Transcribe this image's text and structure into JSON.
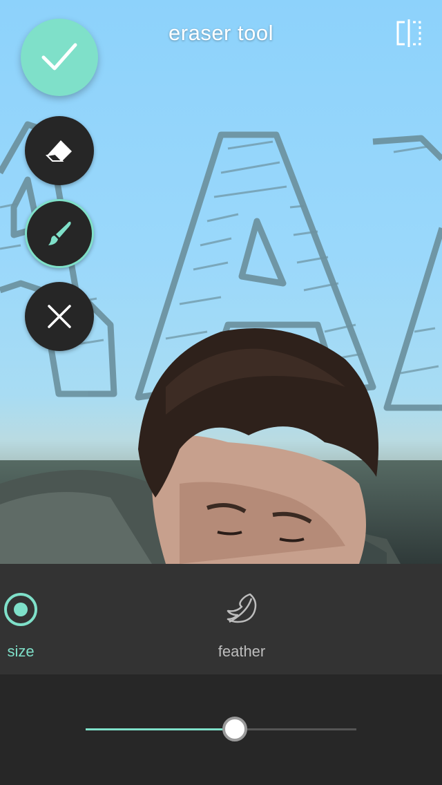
{
  "header": {
    "title": "eraser tool",
    "compare_icon": "split-compare-icon"
  },
  "tools": {
    "confirm_icon": "checkmark-icon",
    "eraser_icon": "eraser-icon",
    "brush_icon": "paintbrush-icon",
    "close_icon": "close-icon",
    "active_tool": "brush"
  },
  "options": [
    {
      "label": "size",
      "icon": "target-circle-icon",
      "active": true
    },
    {
      "label": "feather",
      "icon": "feather-icon",
      "active": false
    }
  ],
  "slider": {
    "value": 0.55
  },
  "colors": {
    "accent": "#7fe0c9",
    "dark_button": "#262626",
    "panel": "#343434",
    "slider_bg": "#272727"
  }
}
